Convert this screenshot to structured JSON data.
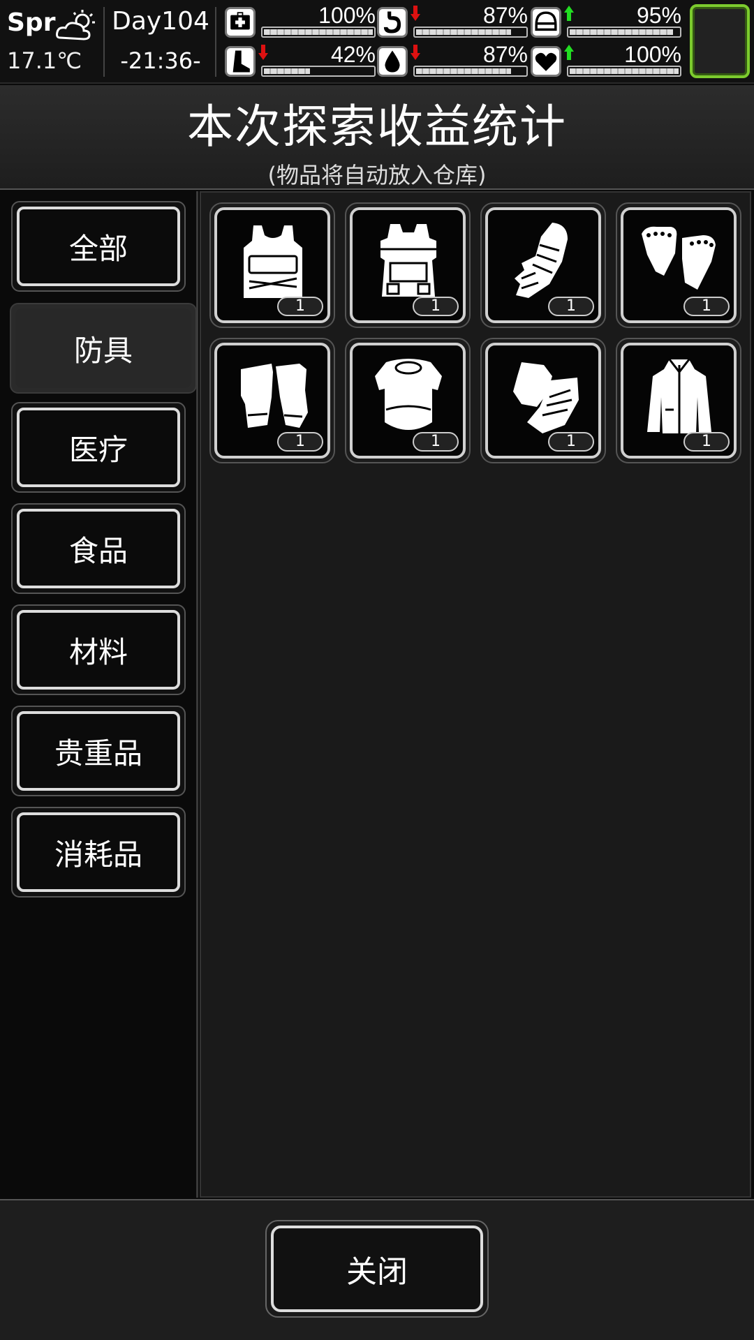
{
  "status": {
    "season": "Spr",
    "weather_icon": "partly-cloudy-icon",
    "temperature": "17.1℃",
    "day": "Day104",
    "time": "-21:36-",
    "stats": [
      {
        "name": "health",
        "icon": "medkit-icon",
        "value": "100%",
        "level": 1.0,
        "trend": "none"
      },
      {
        "name": "hunger",
        "icon": "stomach-icon",
        "value": "87%",
        "level": 0.87,
        "trend": "down"
      },
      {
        "name": "mood",
        "icon": "helmet-icon",
        "value": "95%",
        "level": 0.95,
        "trend": "up"
      },
      {
        "name": "stamina",
        "icon": "foot-icon",
        "value": "42%",
        "level": 0.42,
        "trend": "down"
      },
      {
        "name": "thirst",
        "icon": "water-drop-icon",
        "value": "87%",
        "level": 0.87,
        "trend": "down"
      },
      {
        "name": "spirit",
        "icon": "heart-icon",
        "value": "100%",
        "level": 1.0,
        "trend": "up"
      }
    ],
    "colors": {
      "trend_up": "#22dd22",
      "trend_down": "#dd1111",
      "avatar_frame": "#7ccb2e"
    }
  },
  "header": {
    "title": "本次探索收益统计",
    "subtitle": "(物品将自动放入仓库)"
  },
  "tabs": [
    {
      "label": "全部",
      "active": false
    },
    {
      "label": "防具",
      "active": true
    },
    {
      "label": "医疗",
      "active": false
    },
    {
      "label": "食品",
      "active": false
    },
    {
      "label": "材料",
      "active": false
    },
    {
      "label": "贵重品",
      "active": false
    },
    {
      "label": "消耗品",
      "active": false
    }
  ],
  "items": [
    {
      "icon": "tactical-vest-icon",
      "count": "1"
    },
    {
      "icon": "plate-carrier-icon",
      "count": "1"
    },
    {
      "icon": "armored-gauntlet-icon",
      "count": "1"
    },
    {
      "icon": "fingerless-gloves-icon",
      "count": "1"
    },
    {
      "icon": "half-finger-gloves-icon",
      "count": "1"
    },
    {
      "icon": "body-armor-icon",
      "count": "1"
    },
    {
      "icon": "tactical-gloves-icon",
      "count": "1"
    },
    {
      "icon": "jacket-icon",
      "count": "1"
    }
  ],
  "footer": {
    "close_label": "关闭"
  }
}
